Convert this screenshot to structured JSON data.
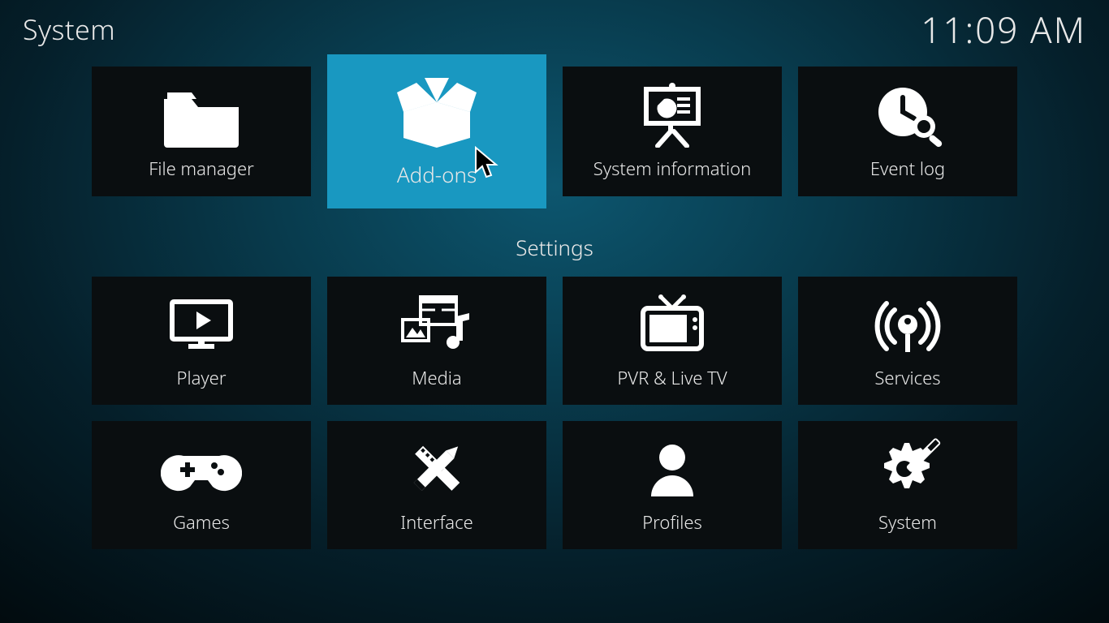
{
  "header": {
    "breadcrumb": "System",
    "clock": "11:09 AM"
  },
  "top_row": [
    {
      "id": "file-manager",
      "label": "File manager",
      "icon": "folder-icon",
      "selected": false
    },
    {
      "id": "add-ons",
      "label": "Add-ons",
      "icon": "open-box-icon",
      "selected": true
    },
    {
      "id": "system-information",
      "label": "System information",
      "icon": "easel-chart-icon",
      "selected": false
    },
    {
      "id": "event-log",
      "label": "Event log",
      "icon": "clock-search-icon",
      "selected": false
    }
  ],
  "section_title": "Settings",
  "settings_row_1": [
    {
      "id": "player",
      "label": "Player",
      "icon": "monitor-play-icon"
    },
    {
      "id": "media",
      "label": "Media",
      "icon": "media-collection-icon"
    },
    {
      "id": "pvr-live-tv",
      "label": "PVR & Live TV",
      "icon": "tv-icon"
    },
    {
      "id": "services",
      "label": "Services",
      "icon": "broadcast-icon"
    }
  ],
  "settings_row_2": [
    {
      "id": "games",
      "label": "Games",
      "icon": "gamepad-icon"
    },
    {
      "id": "interface",
      "label": "Interface",
      "icon": "pencil-ruler-icon"
    },
    {
      "id": "profiles",
      "label": "Profiles",
      "icon": "profile-icon"
    },
    {
      "id": "system",
      "label": "System",
      "icon": "gear-tool-icon"
    }
  ]
}
